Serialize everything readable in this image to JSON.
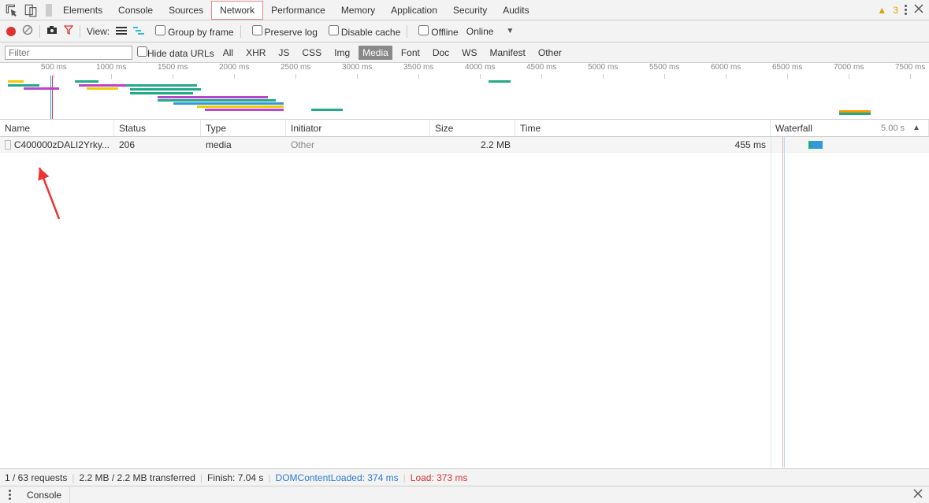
{
  "tabs": {
    "items": [
      "Elements",
      "Console",
      "Sources",
      "Network",
      "Performance",
      "Memory",
      "Application",
      "Security",
      "Audits"
    ],
    "active": "Network",
    "warning_count": "3"
  },
  "toolbar": {
    "view_label": "View:",
    "group_by_frame": "Group by frame",
    "preserve_log": "Preserve log",
    "disable_cache": "Disable cache",
    "offline": "Offline",
    "online": "Online"
  },
  "filterbar": {
    "filter_placeholder": "Filter",
    "hide_data_urls": "Hide data URLs",
    "types": [
      "All",
      "XHR",
      "JS",
      "CSS",
      "Img",
      "Media",
      "Font",
      "Doc",
      "WS",
      "Manifest",
      "Other"
    ],
    "selected": "Media"
  },
  "timeline": {
    "ticks": [
      "500 ms",
      "1000 ms",
      "1500 ms",
      "2000 ms",
      "2500 ms",
      "3000 ms",
      "3500 ms",
      "4000 ms",
      "4500 ms",
      "5000 ms",
      "5500 ms",
      "6000 ms",
      "6500 ms",
      "7000 ms",
      "7500 ms"
    ]
  },
  "table": {
    "headers": {
      "name": "Name",
      "status": "Status",
      "type": "Type",
      "initiator": "Initiator",
      "size": "Size",
      "time": "Time",
      "waterfall": "Waterfall",
      "waterfall_scale": "5.00 s"
    },
    "rows": [
      {
        "name": "C400000zDALI2Yrky...",
        "status": "206",
        "type": "media",
        "initiator": "Other",
        "size": "2.2 MB",
        "time": "455 ms"
      }
    ]
  },
  "status": {
    "requests": "1 / 63 requests",
    "transferred": "2.2 MB / 2.2 MB transferred",
    "finish": "Finish: 7.04 s",
    "dcl": "DOMContentLoaded: 374 ms",
    "load": "Load: 373 ms"
  },
  "drawer": {
    "label": "Console"
  }
}
